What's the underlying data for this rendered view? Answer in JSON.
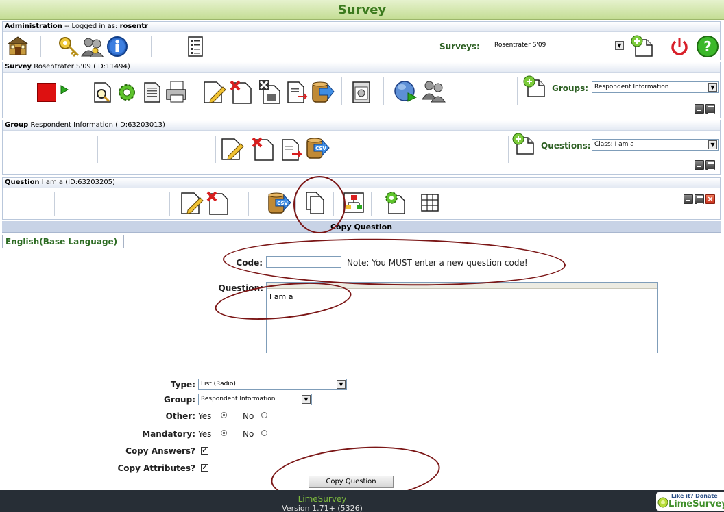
{
  "header": {
    "title": "Survey"
  },
  "admin": {
    "heading": "Administration",
    "logged_in_prefix": " -- Logged in as: ",
    "username": "rosentr",
    "surveys_label": "Surveys:",
    "surveys_selected": "Rosentrater S'09"
  },
  "survey": {
    "heading": "Survey",
    "detail": " Rosentrater S'09 (ID:11494)",
    "groups_label": "Groups:",
    "groups_selected": "Respondent Information"
  },
  "group": {
    "heading": "Group",
    "detail": " Respondent Information (ID:63203013)",
    "questions_label": "Questions:",
    "questions_selected": "Class: I am a"
  },
  "question": {
    "heading": "Question",
    "detail": " I am a (ID:63203205)"
  },
  "copy_form": {
    "title": "Copy Question",
    "tab_label": "English(Base Language)",
    "code_label": "Code:",
    "code_value": "",
    "code_note": "Note: You MUST enter a new question code!",
    "question_label": "Question:",
    "question_text": "I am a",
    "type_label": "Type:",
    "type_value": "List (Radio)",
    "group_label": "Group:",
    "group_value": "Respondent Information",
    "other_label": "Other:",
    "mandatory_label": "Mandatory:",
    "yes_label": "Yes",
    "no_label": "No",
    "copy_answers_label": "Copy Answers?",
    "copy_attributes_label": "Copy Attributes?",
    "submit_label": "Copy Question"
  },
  "footer": {
    "product": "LimeSurvey",
    "version": "Version 1.71+ (5326)",
    "donate_line1": "Like it? Donate",
    "donate_line2": "LimeSurvey"
  },
  "colors": {
    "title_green": "#3b7a1e",
    "label_green": "#2c5f22",
    "annotation_ring": "#7b1616",
    "footer_bg": "#272e36"
  }
}
